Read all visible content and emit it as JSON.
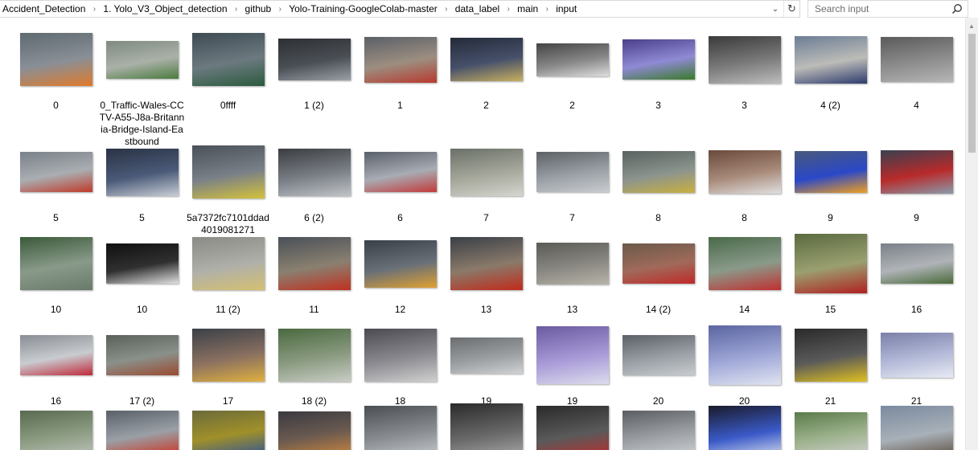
{
  "address_bar": {
    "breadcrumbs": [
      "Accident_Detection",
      "1. Yolo_V3_Object_detection",
      "github",
      "Yolo-Training-GoogleColab-master",
      "data_label",
      "main",
      "input"
    ]
  },
  "search": {
    "placeholder": "Search input"
  },
  "files": [
    {
      "name": "0",
      "colors": [
        "#5e6a70",
        "#8a8f96",
        "#e07a2a"
      ]
    },
    {
      "name": "0_Traffic-Wales-CCTV-A55-J8a-Britannia-Bridge-Island-Eastbound",
      "colors": [
        "#7f8a80",
        "#aab1a8",
        "#4b7b3f"
      ]
    },
    {
      "name": "0ffff",
      "colors": [
        "#3d4a52",
        "#6c7a80",
        "#2b5a3d"
      ]
    },
    {
      "name": "1 (2)",
      "colors": [
        "#2d3034",
        "#4a4f55",
        "#9aa0a6"
      ]
    },
    {
      "name": "1",
      "colors": [
        "#5a6068",
        "#9c8e80",
        "#b83a2e"
      ]
    },
    {
      "name": "2",
      "colors": [
        "#232a38",
        "#46506a",
        "#c8b060"
      ]
    },
    {
      "name": "2",
      "colors": [
        "#444444",
        "#888888",
        "#dddddd"
      ]
    },
    {
      "name": "3",
      "colors": [
        "#4a3f8a",
        "#8f8ad4",
        "#3a7a2a"
      ]
    },
    {
      "name": "3",
      "colors": [
        "#3a3a3a",
        "#7a7a7a",
        "#bdbdbd"
      ]
    },
    {
      "name": "4 (2)",
      "colors": [
        "#6c7d95",
        "#bcbcb8",
        "#2e3b6e"
      ]
    },
    {
      "name": "4",
      "colors": [
        "#5a5a5a",
        "#8d8d8d",
        "#b6b6b6"
      ]
    },
    {
      "name": "5",
      "colors": [
        "#7a8088",
        "#a9aeb2",
        "#c03a2a"
      ]
    },
    {
      "name": "5",
      "colors": [
        "#2a3244",
        "#4a5a78",
        "#c9ced6"
      ]
    },
    {
      "name": "5a7372fc7101ddad4019081271",
      "colors": [
        "#4a5058",
        "#7a8088",
        "#d4c23a"
      ]
    },
    {
      "name": "6 (2)",
      "colors": [
        "#3a3c40",
        "#7a7f86",
        "#c0c4c8"
      ]
    },
    {
      "name": "6",
      "colors": [
        "#5a606a",
        "#a8acb4",
        "#c23a3a"
      ]
    },
    {
      "name": "7",
      "colors": [
        "#6a7068",
        "#a6a89c",
        "#d4d6d0"
      ]
    },
    {
      "name": "7",
      "colors": [
        "#5d6166",
        "#9aa0a6",
        "#c9ccd0"
      ]
    },
    {
      "name": "8",
      "colors": [
        "#5a6260",
        "#8c948e",
        "#c8b040"
      ]
    },
    {
      "name": "8",
      "colors": [
        "#6a4a3a",
        "#a88a7a",
        "#e0e0e0"
      ]
    },
    {
      "name": "9",
      "colors": [
        "#4a5a7a",
        "#2a48c8",
        "#f0a020"
      ]
    },
    {
      "name": "9",
      "colors": [
        "#3a4050",
        "#b82a2a",
        "#8a9aaa"
      ]
    },
    {
      "name": "10",
      "colors": [
        "#3a5a3a",
        "#8a9a8a",
        "#6a7a6a"
      ]
    },
    {
      "name": "10",
      "colors": [
        "#101010",
        "#303030",
        "#e0e0e0"
      ]
    },
    {
      "name": "11 (2)",
      "colors": [
        "#8a8a86",
        "#b0b0aa",
        "#d4c070"
      ]
    },
    {
      "name": "11",
      "colors": [
        "#4a5058",
        "#8a8070",
        "#c03020"
      ]
    },
    {
      "name": "12",
      "colors": [
        "#3a4048",
        "#6a7078",
        "#e0a030"
      ]
    },
    {
      "name": "13",
      "colors": [
        "#3a3f48",
        "#8a7a6a",
        "#c02a1a"
      ]
    },
    {
      "name": "13",
      "colors": [
        "#5a5a56",
        "#8a8882",
        "#b8b4aa"
      ]
    },
    {
      "name": "14 (2)",
      "colors": [
        "#6a5a4a",
        "#a06a5a",
        "#c02a2a"
      ]
    },
    {
      "name": "14",
      "colors": [
        "#4a6a4a",
        "#8a9a8a",
        "#c03030"
      ]
    },
    {
      "name": "15",
      "colors": [
        "#5a6a40",
        "#9aa070",
        "#b02020"
      ]
    },
    {
      "name": "16",
      "colors": [
        "#7a8088",
        "#b0b4b8",
        "#4a6a3a"
      ]
    },
    {
      "name": "16",
      "colors": [
        "#8a8e94",
        "#c8ccd0",
        "#c02a3a"
      ]
    },
    {
      "name": "17 (2)",
      "colors": [
        "#5a605a",
        "#8a908a",
        "#9a4a30"
      ]
    },
    {
      "name": "17",
      "colors": [
        "#3a4048",
        "#8a7060",
        "#e0b040"
      ]
    },
    {
      "name": "18 (2)",
      "colors": [
        "#4a6a40",
        "#8a9a80",
        "#c8ccc4"
      ]
    },
    {
      "name": "18",
      "colors": [
        "#4a4a50",
        "#8a8a90",
        "#d0d0d0"
      ]
    },
    {
      "name": "19",
      "colors": [
        "#6a6e70",
        "#9a9ea0",
        "#d0d2d4"
      ]
    },
    {
      "name": "19",
      "colors": [
        "#6a5aa0",
        "#a89ad8",
        "#dcdcec"
      ]
    },
    {
      "name": "20",
      "colors": [
        "#5a6066",
        "#9aa0a6",
        "#c8ccd0"
      ]
    },
    {
      "name": "20",
      "colors": [
        "#5a64a0",
        "#a0a8d8",
        "#e0e4f0"
      ]
    },
    {
      "name": "21",
      "colors": [
        "#2a2a2a",
        "#5a5a5a",
        "#e0c020"
      ]
    },
    {
      "name": "21",
      "colors": [
        "#7a80a8",
        "#b4bad8",
        "#e8eaf4"
      ]
    },
    {
      "name": "",
      "colors": [
        "#5a6a50",
        "#8a9a80",
        "#b8beb4"
      ]
    },
    {
      "name": "",
      "colors": [
        "#5a6068",
        "#9aa0a6",
        "#c83a2a"
      ]
    },
    {
      "name": "",
      "colors": [
        "#6a6a3a",
        "#a0902a",
        "#3a5a8a"
      ]
    },
    {
      "name": "",
      "colors": [
        "#3a3a40",
        "#6a5a50",
        "#c08040"
      ]
    },
    {
      "name": "",
      "colors": [
        "#4a4e52",
        "#8a8e92",
        "#c8ccd0"
      ]
    },
    {
      "name": "",
      "colors": [
        "#2a2a2a",
        "#6a6a6a",
        "#b0b0b0"
      ]
    },
    {
      "name": "",
      "colors": [
        "#2a2a2a",
        "#5a5a5a",
        "#c02a2a"
      ]
    },
    {
      "name": "",
      "colors": [
        "#5a5e62",
        "#9a9ea2",
        "#c8ccd0"
      ]
    },
    {
      "name": "",
      "colors": [
        "#1a1a2a",
        "#3a5ac8",
        "#e0e4f0"
      ]
    },
    {
      "name": "",
      "colors": [
        "#5a7a4a",
        "#9ab08a",
        "#c8ccc4"
      ]
    },
    {
      "name": "",
      "colors": [
        "#7a8aa0",
        "#a8b0b8",
        "#5a4a3a"
      ]
    }
  ]
}
